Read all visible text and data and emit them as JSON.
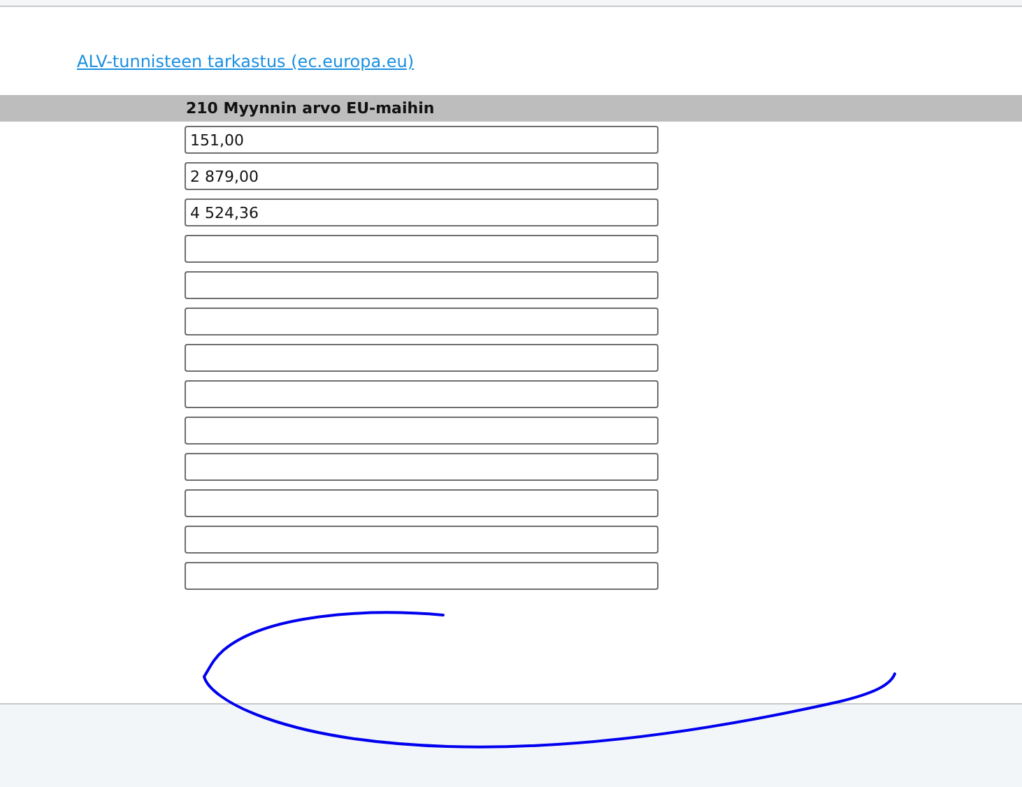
{
  "link": "ALV-tunnisteen tarkastus (ec.europa.eu)",
  "section": {
    "heading": "210 Myynnin arvo EU-maihin",
    "fields": [
      {
        "kind": "filled",
        "value": "151,00"
      },
      {
        "kind": "filled",
        "value": "2 879,00"
      },
      {
        "kind": "filled",
        "value": "4 524,36"
      },
      {
        "kind": "empty"
      },
      {
        "kind": "empty"
      },
      {
        "kind": "empty"
      },
      {
        "kind": "empty"
      },
      {
        "kind": "empty"
      },
      {
        "kind": "empty"
      },
      {
        "kind": "empty"
      },
      {
        "kind": "empty"
      },
      {
        "kind": "empty"
      },
      {
        "kind": "empty"
      }
    ]
  }
}
